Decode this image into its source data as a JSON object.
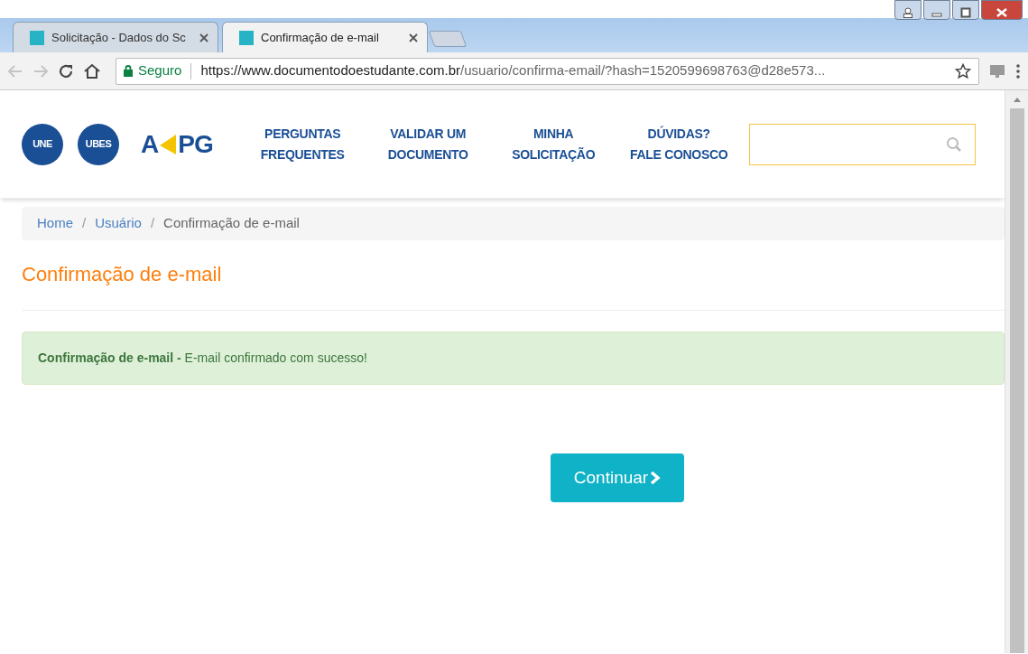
{
  "browser": {
    "tabs": [
      {
        "title": "Solicitação - Dados do Sc",
        "selected": false
      },
      {
        "title": "Confirmação de e-mail",
        "selected": true
      }
    ],
    "address": {
      "security_label": "Seguro",
      "url_host": "https://www.documentodoestudante.com.br",
      "url_path": "/usuario/confirma-email/?hash=1520599698763@d28e573..."
    }
  },
  "header": {
    "logos": [
      {
        "kind": "globe",
        "text": "UNE"
      },
      {
        "kind": "globe",
        "text": "UBES"
      },
      {
        "kind": "wordmark",
        "text_before": "A",
        "text_after": "PG"
      }
    ],
    "nav": [
      {
        "lines": [
          "PERGUNTAS",
          "FREQUENTES"
        ]
      },
      {
        "lines": [
          "VALIDAR UM",
          "DOCUMENTO"
        ]
      },
      {
        "lines": [
          "MINHA",
          "SOLICITAÇÃO"
        ]
      },
      {
        "lines": [
          "DÚVIDAS?",
          "FALE CONOSCO"
        ]
      }
    ]
  },
  "breadcrumb_separator": "/",
  "breadcrumb": [
    {
      "label": "Home",
      "current": false
    },
    {
      "label": "Usuário",
      "current": false
    },
    {
      "label": "Confirmação de e-mail",
      "current": true
    }
  ],
  "page_title": "Confirmação de e-mail",
  "alert": {
    "text": "**Confirmação de e-mail -** E-mail confirmado com sucesso!"
  },
  "continue_button": {
    "label": "Continuar"
  }
}
